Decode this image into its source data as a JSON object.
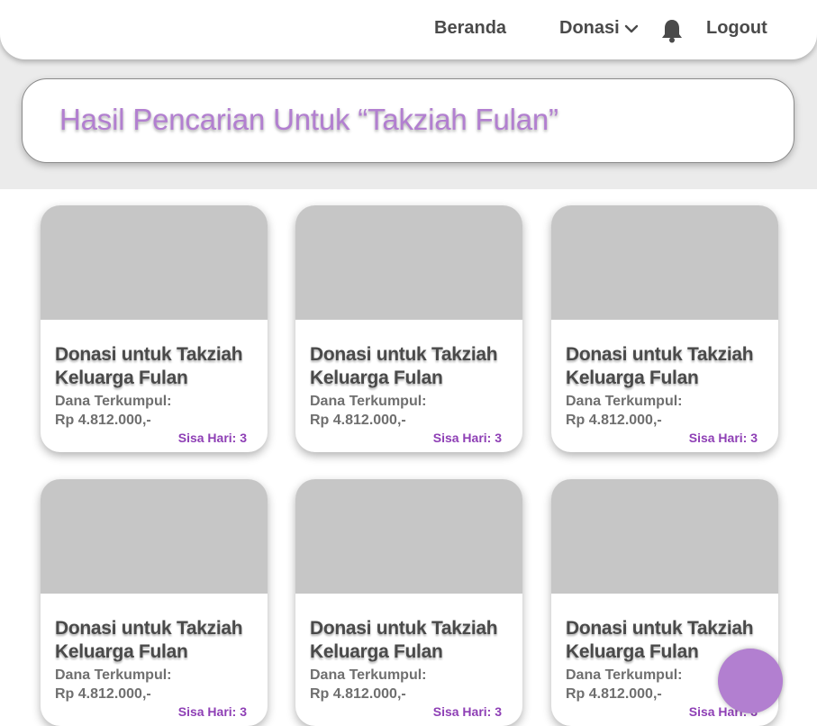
{
  "nav": {
    "beranda": "Beranda",
    "donasi": "Donasi",
    "logout": "Logout",
    "icons": [
      "chevron-down-icon",
      "bell-icon"
    ]
  },
  "search": {
    "title": "Hasil Pencarian Untuk “Takziah Fulan”"
  },
  "cards": [
    {
      "title": "Donasi untuk Takziah Keluarga Fulan",
      "label": "Dana Terkumpul:",
      "amount": "Rp 4.812.000,-",
      "days": "Sisa Hari: 3"
    },
    {
      "title": "Donasi untuk Takziah Keluarga Fulan",
      "label": "Dana Terkumpul:",
      "amount": "Rp 4.812.000,-",
      "days": "Sisa Hari: 3"
    },
    {
      "title": "Donasi untuk Takziah Keluarga Fulan",
      "label": "Dana Terkumpul:",
      "amount": "Rp 4.812.000,-",
      "days": "Sisa Hari: 3"
    },
    {
      "title": "Donasi untuk Takziah Keluarga Fulan",
      "label": "Dana Terkumpul:",
      "amount": "Rp 4.812.000,-",
      "days": "Sisa Hari: 3"
    },
    {
      "title": "Donasi untuk Takziah Keluarga Fulan",
      "label": "Dana Terkumpul:",
      "amount": "Rp 4.812.000,-",
      "days": "Sisa Hari: 3"
    },
    {
      "title": "Donasi untuk Takziah Keluarga Fulan",
      "label": "Dana Terkumpul:",
      "amount": "Rp 4.812.000,-",
      "days": "Sisa Hari: 3"
    }
  ],
  "colors": {
    "accent": "#b27fd0",
    "days": "#8e3fb5",
    "text": "#4a4a4a",
    "placeholder": "#c6c6c6"
  }
}
